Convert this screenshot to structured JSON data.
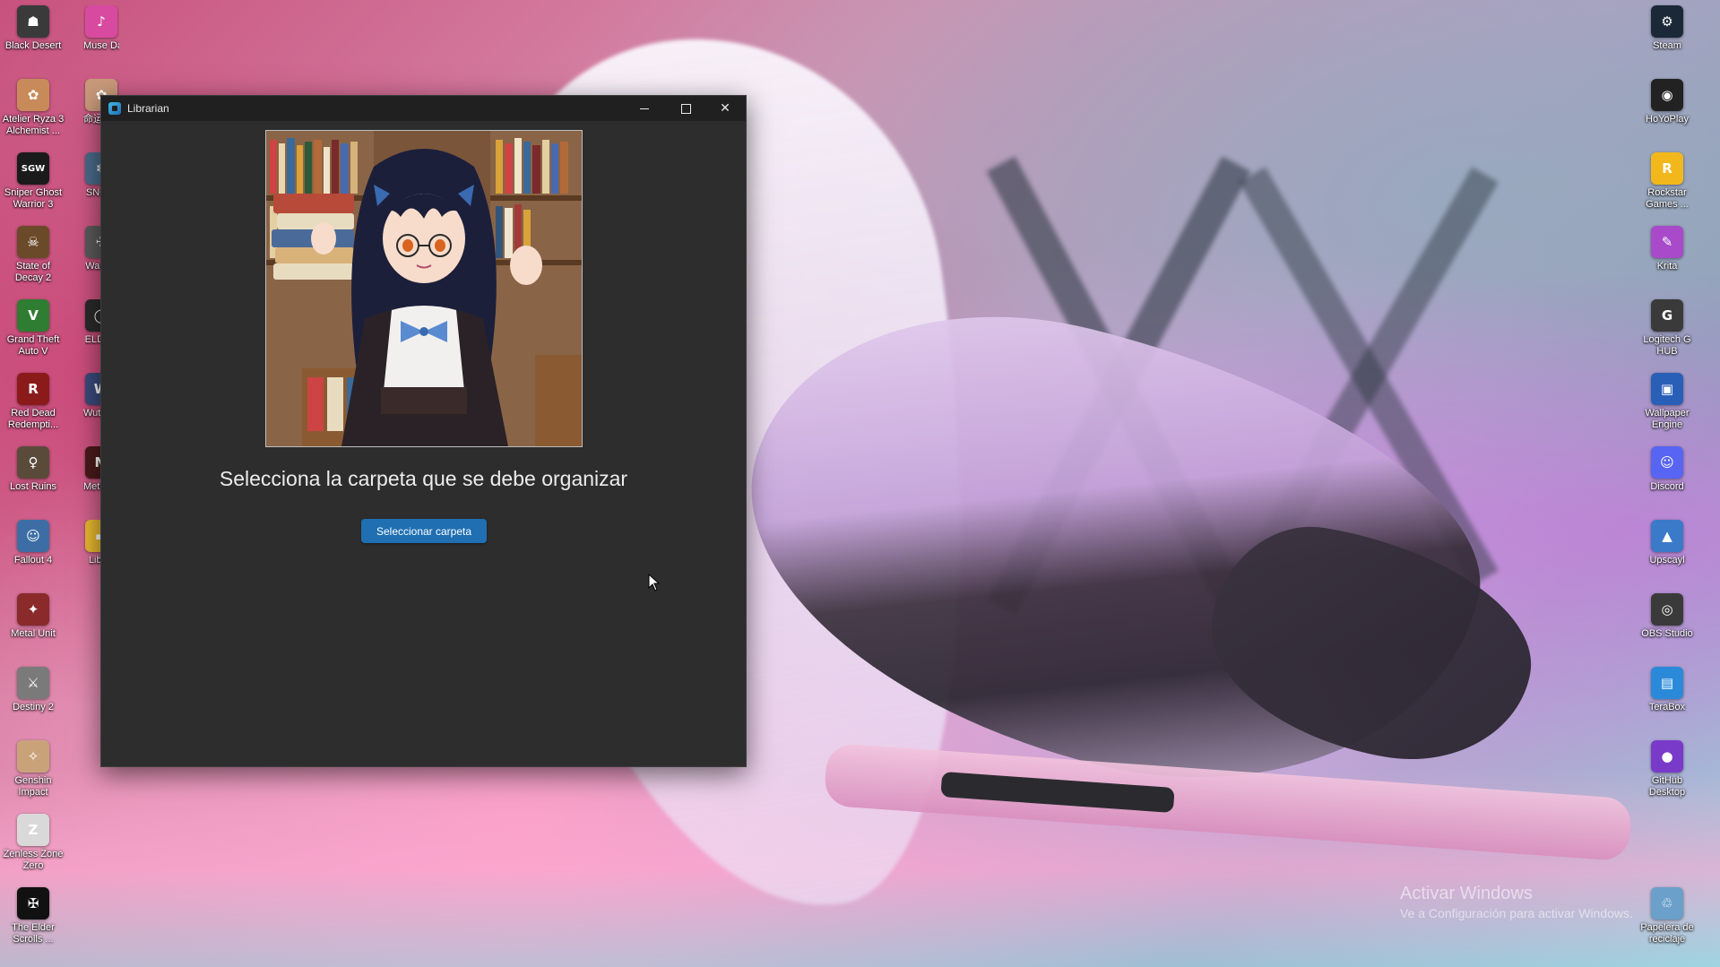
{
  "desktop": {
    "left_icons": [
      {
        "label": "Black Desert",
        "icon": "black-desert-icon",
        "color": "#3a3a3a",
        "glyph": "☗"
      },
      {
        "label": "Atelier Ryza 3\nAlchemist ...",
        "icon": "atelier-ryza-icon",
        "color": "#c98a5a",
        "glyph": "✿"
      },
      {
        "label": "Sniper Ghost\nWarrior 3",
        "icon": "sniper-ghost-icon",
        "color": "#1b1b1b",
        "glyph": "SGW"
      },
      {
        "label": "State of\nDecay 2",
        "icon": "state-of-decay-icon",
        "color": "#6b4a2a",
        "glyph": "☠"
      },
      {
        "label": "Grand Theft\nAuto V",
        "icon": "gta-v-icon",
        "color": "#2f7d32",
        "glyph": "V"
      },
      {
        "label": "Red Dead\nRedempti...",
        "icon": "red-dead-icon",
        "color": "#8b1a1a",
        "glyph": "R"
      },
      {
        "label": "Lost Ruins",
        "icon": "lost-ruins-icon",
        "color": "#5a4a3a",
        "glyph": "♀"
      },
      {
        "label": "Fallout 4",
        "icon": "fallout-icon",
        "color": "#3c6ea5",
        "glyph": "☺"
      },
      {
        "label": "Metal Unit",
        "icon": "metal-unit-icon",
        "color": "#8a2a2a",
        "glyph": "✦"
      },
      {
        "label": "Destiny 2",
        "icon": "destiny-icon",
        "color": "#7a7a7a",
        "glyph": "⚔"
      },
      {
        "label": "Genshin\nImpact",
        "icon": "genshin-icon",
        "color": "#c9a27a",
        "glyph": "✧"
      },
      {
        "label": "Zenless Zone\nZero",
        "icon": "zenless-icon",
        "color": "#d9d9d9",
        "glyph": "Z"
      },
      {
        "label": "The Elder\nScrolls ...",
        "icon": "elder-scrolls-icon",
        "color": "#111111",
        "glyph": "✠"
      }
    ],
    "second_col_icons": [
      {
        "label": "Muse Dash",
        "icon": "muse-dash-icon",
        "color": "#d84aa0",
        "glyph": "♪"
      },
      {
        "label": "命运冠位\n吧",
        "icon": "game-cn-icon",
        "color": "#c99a7a",
        "glyph": "✿"
      },
      {
        "label": "SNOW",
        "icon": "snow-icon",
        "color": "#4a6a8a",
        "glyph": "❄"
      },
      {
        "label": "War Th",
        "icon": "war-thunder-icon",
        "color": "#5a5a5a",
        "glyph": "✈"
      },
      {
        "label": "ELDEN",
        "icon": "elden-ring-icon",
        "color": "#2a2a2a",
        "glyph": "◯"
      },
      {
        "label": "Wuth\nWa",
        "icon": "wuthering-icon",
        "color": "#3a4a7a",
        "glyph": "W"
      },
      {
        "label": "Metro\nRe",
        "icon": "metro-icon",
        "color": "#4a1a1a",
        "glyph": "M"
      },
      {
        "label": "Librar",
        "icon": "folder-icon",
        "color": "#e8b830",
        "glyph": "▬"
      }
    ],
    "right_icons": [
      {
        "label": "Steam",
        "icon": "steam-icon",
        "color": "#1b2838",
        "glyph": "⚙"
      },
      {
        "label": "HoYoPlay",
        "icon": "hoyoplay-icon",
        "color": "#222222",
        "glyph": "◉"
      },
      {
        "label": "Rockstar\nGames ...",
        "icon": "rockstar-icon",
        "color": "#f2b81b",
        "glyph": "R"
      },
      {
        "label": "Krita",
        "icon": "krita-icon",
        "color": "#a84ac9",
        "glyph": "✎"
      },
      {
        "label": "Logitech G\nHUB",
        "icon": "logitech-icon",
        "color": "#3a3a3a",
        "glyph": "G"
      },
      {
        "label": "Wallpaper\nEngine",
        "icon": "wallpaper-engine-icon",
        "color": "#2a5fb8",
        "glyph": "▣"
      },
      {
        "label": "Discord",
        "icon": "discord-icon",
        "color": "#5865f2",
        "glyph": "☺"
      },
      {
        "label": "Upscayl",
        "icon": "upscayl-icon",
        "color": "#3a7ac9",
        "glyph": "▲"
      },
      {
        "label": "OBS Studio",
        "icon": "obs-icon",
        "color": "#3a3a3a",
        "glyph": "◎"
      },
      {
        "label": "TeraBox",
        "icon": "terabox-icon",
        "color": "#2a8ad9",
        "glyph": "▤"
      },
      {
        "label": "GitHub\nDesktop",
        "icon": "github-icon",
        "color": "#7a3ac9",
        "glyph": "●"
      },
      {
        "label": "Papelera de\nreciclaje",
        "icon": "recycle-bin-icon",
        "color": "#6aa0c9",
        "glyph": "♲"
      }
    ],
    "watermark": {
      "line1": "Activar Windows",
      "line2": "Ve a Configuración para activar Windows."
    }
  },
  "window": {
    "title": "Librarian",
    "prompt": "Selecciona la carpeta que se debe organizar",
    "select_button": "Seleccionar carpeta",
    "hero_image": "librarian-girl-illustration"
  }
}
